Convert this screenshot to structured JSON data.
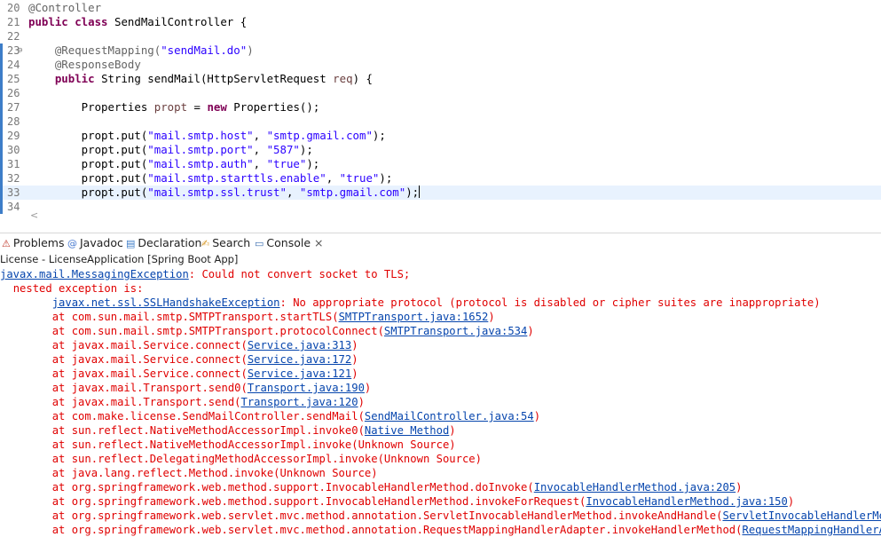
{
  "editor": {
    "lines": [
      {
        "num": "20",
        "tokens": [
          {
            "t": "@Controller",
            "c": "ann"
          }
        ]
      },
      {
        "num": "21",
        "tokens": [
          {
            "t": "public class",
            "c": "kw"
          },
          {
            "t": " SendMailController {",
            "c": ""
          }
        ]
      },
      {
        "num": "22",
        "tokens": []
      },
      {
        "num": "23",
        "fold": "⊖",
        "tokens": [
          {
            "t": "    @RequestMapping(",
            "c": "ann"
          },
          {
            "t": "\"sendMail.do\"",
            "c": "str"
          },
          {
            "t": ")",
            "c": "ann"
          }
        ]
      },
      {
        "num": "24",
        "tokens": [
          {
            "t": "    @ResponseBody",
            "c": "ann"
          }
        ]
      },
      {
        "num": "25",
        "tokens": [
          {
            "t": "    ",
            "c": ""
          },
          {
            "t": "public",
            "c": "kw"
          },
          {
            "t": " String sendMail(HttpServletRequest ",
            "c": ""
          },
          {
            "t": "req",
            "c": "var"
          },
          {
            "t": ") {",
            "c": ""
          }
        ]
      },
      {
        "num": "26",
        "tokens": []
      },
      {
        "num": "27",
        "tokens": [
          {
            "t": "        Properties ",
            "c": ""
          },
          {
            "t": "propt",
            "c": "var"
          },
          {
            "t": " = ",
            "c": ""
          },
          {
            "t": "new",
            "c": "kw"
          },
          {
            "t": " Properties();",
            "c": ""
          }
        ]
      },
      {
        "num": "28",
        "tokens": []
      },
      {
        "num": "29",
        "tokens": [
          {
            "t": "        propt.put(",
            "c": ""
          },
          {
            "t": "\"mail.smtp.host\"",
            "c": "str"
          },
          {
            "t": ", ",
            "c": ""
          },
          {
            "t": "\"smtp.gmail.com\"",
            "c": "str"
          },
          {
            "t": ");",
            "c": ""
          }
        ]
      },
      {
        "num": "30",
        "tokens": [
          {
            "t": "        propt.put(",
            "c": ""
          },
          {
            "t": "\"mail.smtp.port\"",
            "c": "str"
          },
          {
            "t": ", ",
            "c": ""
          },
          {
            "t": "\"587\"",
            "c": "str"
          },
          {
            "t": ");",
            "c": ""
          }
        ]
      },
      {
        "num": "31",
        "tokens": [
          {
            "t": "        propt.put(",
            "c": ""
          },
          {
            "t": "\"mail.smtp.auth\"",
            "c": "str"
          },
          {
            "t": ", ",
            "c": ""
          },
          {
            "t": "\"true\"",
            "c": "str"
          },
          {
            "t": ");",
            "c": ""
          }
        ]
      },
      {
        "num": "32",
        "tokens": [
          {
            "t": "        propt.put(",
            "c": ""
          },
          {
            "t": "\"mail.smtp.starttls.enable\"",
            "c": "str"
          },
          {
            "t": ", ",
            "c": ""
          },
          {
            "t": "\"true\"",
            "c": "str"
          },
          {
            "t": ");",
            "c": ""
          }
        ]
      },
      {
        "num": "33",
        "current": true,
        "tokens": [
          {
            "t": "        propt.put(",
            "c": ""
          },
          {
            "t": "\"mail.smtp.ssl.trust\"",
            "c": "str"
          },
          {
            "t": ", ",
            "c": ""
          },
          {
            "t": "\"smtp.gmail.com\"",
            "c": "str"
          },
          {
            "t": ");",
            "c": ""
          }
        ]
      },
      {
        "num": "34",
        "tokens": []
      }
    ],
    "scroll_left_arrow": "<"
  },
  "tabs": [
    {
      "icon": "problems-icon",
      "glyph": "⚠",
      "label": "Problems",
      "active": false
    },
    {
      "icon": "javadoc-icon",
      "glyph": "@",
      "label": "Javadoc",
      "active": false
    },
    {
      "icon": "declaration-icon",
      "glyph": "▤",
      "label": "Declaration",
      "active": false
    },
    {
      "icon": "search-icon",
      "glyph": "✍",
      "label": "Search",
      "active": false
    },
    {
      "icon": "console-icon",
      "glyph": "▭",
      "label": "Console",
      "active": true,
      "close": "×"
    }
  ],
  "console": {
    "title": "License - LicenseApplication [Spring Boot App]",
    "lines": [
      {
        "indent": "",
        "parts": [
          {
            "t": "javax.mail.MessagingException",
            "link": true
          },
          {
            "t": ": Could not convert socket to TLS;"
          }
        ]
      },
      {
        "indent": "  ",
        "parts": [
          {
            "t": "nested exception is:"
          }
        ]
      },
      {
        "indent": "        ",
        "parts": [
          {
            "t": "javax.net.ssl.SSLHandshakeException",
            "link": true
          },
          {
            "t": ": No appropriate protocol (protocol is disabled or cipher suites are inappropriate)"
          }
        ]
      },
      {
        "indent": "        ",
        "parts": [
          {
            "t": "at com.sun.mail.smtp.SMTPTransport.startTLS("
          },
          {
            "t": "SMTPTransport.java:1652",
            "link": true
          },
          {
            "t": ")"
          }
        ]
      },
      {
        "indent": "        ",
        "parts": [
          {
            "t": "at com.sun.mail.smtp.SMTPTransport.protocolConnect("
          },
          {
            "t": "SMTPTransport.java:534",
            "link": true
          },
          {
            "t": ")"
          }
        ]
      },
      {
        "indent": "        ",
        "parts": [
          {
            "t": "at javax.mail.Service.connect("
          },
          {
            "t": "Service.java:313",
            "link": true
          },
          {
            "t": ")"
          }
        ]
      },
      {
        "indent": "        ",
        "parts": [
          {
            "t": "at javax.mail.Service.connect("
          },
          {
            "t": "Service.java:172",
            "link": true
          },
          {
            "t": ")"
          }
        ]
      },
      {
        "indent": "        ",
        "parts": [
          {
            "t": "at javax.mail.Service.connect("
          },
          {
            "t": "Service.java:121",
            "link": true
          },
          {
            "t": ")"
          }
        ]
      },
      {
        "indent": "        ",
        "parts": [
          {
            "t": "at javax.mail.Transport.send0("
          },
          {
            "t": "Transport.java:190",
            "link": true
          },
          {
            "t": ")"
          }
        ]
      },
      {
        "indent": "        ",
        "parts": [
          {
            "t": "at javax.mail.Transport.send("
          },
          {
            "t": "Transport.java:120",
            "link": true
          },
          {
            "t": ")"
          }
        ]
      },
      {
        "indent": "        ",
        "parts": [
          {
            "t": "at com.make.license.SendMailController.sendMail("
          },
          {
            "t": "SendMailController.java:54",
            "link": true
          },
          {
            "t": ")"
          }
        ]
      },
      {
        "indent": "        ",
        "parts": [
          {
            "t": "at sun.reflect.NativeMethodAccessorImpl.invoke0("
          },
          {
            "t": "Native Method",
            "link": true
          },
          {
            "t": ")"
          }
        ]
      },
      {
        "indent": "        ",
        "parts": [
          {
            "t": "at sun.reflect.NativeMethodAccessorImpl.invoke(Unknown Source)"
          }
        ]
      },
      {
        "indent": "        ",
        "parts": [
          {
            "t": "at sun.reflect.DelegatingMethodAccessorImpl.invoke(Unknown Source)"
          }
        ]
      },
      {
        "indent": "        ",
        "parts": [
          {
            "t": "at java.lang.reflect.Method.invoke(Unknown Source)"
          }
        ]
      },
      {
        "indent": "        ",
        "parts": [
          {
            "t": "at org.springframework.web.method.support.InvocableHandlerMethod.doInvoke("
          },
          {
            "t": "InvocableHandlerMethod.java:205",
            "link": true
          },
          {
            "t": ")"
          }
        ]
      },
      {
        "indent": "        ",
        "parts": [
          {
            "t": "at org.springframework.web.method.support.InvocableHandlerMethod.invokeForRequest("
          },
          {
            "t": "InvocableHandlerMethod.java:150",
            "link": true
          },
          {
            "t": ")"
          }
        ]
      },
      {
        "indent": "        ",
        "parts": [
          {
            "t": "at org.springframework.web.servlet.mvc.method.annotation.ServletInvocableHandlerMethod.invokeAndHandle("
          },
          {
            "t": "ServletInvocableHandlerMeth",
            "link": true
          }
        ]
      },
      {
        "indent": "        ",
        "parts": [
          {
            "t": "at org.springframework.web.servlet.mvc.method.annotation.RequestMappingHandlerAdapter.invokeHandlerMethod("
          },
          {
            "t": "RequestMappingHandlerAda",
            "link": true
          }
        ]
      }
    ]
  },
  "colors": {
    "error": "#e00000",
    "link": "#0645ad",
    "keyword": "#7f0055",
    "string": "#2a00ff",
    "annotation": "#646464",
    "gutter": "#3d7dc8"
  }
}
